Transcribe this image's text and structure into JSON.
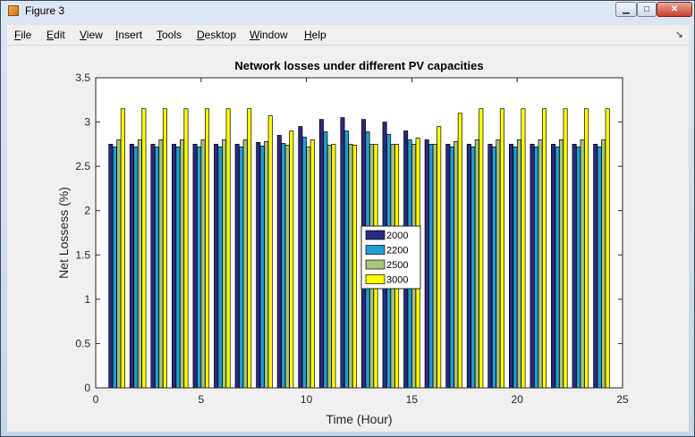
{
  "window": {
    "title": "Figure 3"
  },
  "window_controls": {
    "minimize": "▁",
    "maximize": "□",
    "close": "✕"
  },
  "menubar": {
    "items": [
      {
        "key": "F",
        "rest": "ile"
      },
      {
        "key": "E",
        "rest": "dit"
      },
      {
        "key": "V",
        "rest": "iew"
      },
      {
        "key": "I",
        "rest": "nsert"
      },
      {
        "key": "T",
        "rest": "ools"
      },
      {
        "key": "D",
        "rest": "esktop"
      },
      {
        "key": "W",
        "rest": "indow"
      },
      {
        "key": "H",
        "rest": "elp"
      }
    ],
    "dock_arrow": "↘"
  },
  "colors": {
    "2000": "#2b2a80",
    "2200": "#1f9fd2",
    "2500": "#a8c47e",
    "3000": "#ffff00"
  },
  "chart_data": {
    "type": "bar",
    "title": "Network losses under different PV capacities",
    "xlabel": "Time (Hour)",
    "ylabel": "Net   Lossess (%)",
    "xlim": [
      0,
      25
    ],
    "ylim": [
      0,
      3.5
    ],
    "xticks": [
      "0",
      "5",
      "10",
      "15",
      "20",
      "25"
    ],
    "yticks": [
      "0",
      "0.5",
      "1",
      "1.5",
      "2",
      "2.5",
      "3",
      "3.5"
    ],
    "categories": [
      1,
      2,
      3,
      4,
      5,
      6,
      7,
      8,
      9,
      10,
      11,
      12,
      13,
      14,
      15,
      16,
      17,
      18,
      19,
      20,
      21,
      22,
      23,
      24
    ],
    "legend_position": "center",
    "series": [
      {
        "name": "2000",
        "values": [
          2.75,
          2.75,
          2.75,
          2.75,
          2.75,
          2.75,
          2.75,
          2.77,
          2.85,
          2.95,
          3.03,
          3.05,
          3.03,
          3.0,
          2.9,
          2.8,
          2.75,
          2.75,
          2.75,
          2.75,
          2.75,
          2.75,
          2.75,
          2.75
        ]
      },
      {
        "name": "2200",
        "values": [
          2.72,
          2.72,
          2.72,
          2.72,
          2.72,
          2.72,
          2.72,
          2.73,
          2.76,
          2.83,
          2.89,
          2.9,
          2.89,
          2.86,
          2.8,
          2.75,
          2.72,
          2.72,
          2.72,
          2.72,
          2.72,
          2.72,
          2.72,
          2.72
        ]
      },
      {
        "name": "2500",
        "values": [
          2.8,
          2.8,
          2.8,
          2.8,
          2.8,
          2.8,
          2.8,
          2.78,
          2.74,
          2.72,
          2.74,
          2.75,
          2.75,
          2.75,
          2.75,
          2.75,
          2.78,
          2.8,
          2.8,
          2.8,
          2.8,
          2.8,
          2.8,
          2.8
        ]
      },
      {
        "name": "3000",
        "values": [
          3.15,
          3.15,
          3.15,
          3.15,
          3.15,
          3.15,
          3.15,
          3.07,
          2.9,
          2.8,
          2.75,
          2.74,
          2.75,
          2.75,
          2.82,
          2.95,
          3.1,
          3.15,
          3.15,
          3.15,
          3.15,
          3.15,
          3.15,
          3.15
        ]
      }
    ]
  }
}
